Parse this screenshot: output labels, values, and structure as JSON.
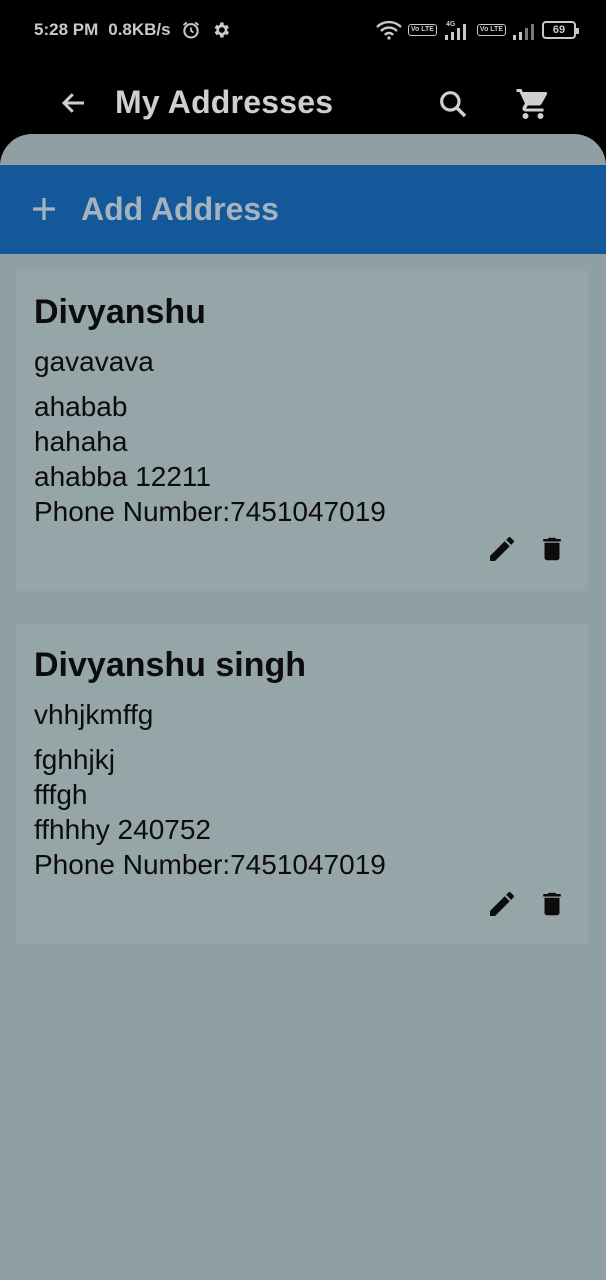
{
  "status_bar": {
    "time": "5:28 PM",
    "speed": "0.8KB/s",
    "network_type": "4G",
    "volte_label": "Vo LTE",
    "battery": "69",
    "icons": [
      "alarm-icon",
      "settings-icon",
      "wifi-icon",
      "signal-icon",
      "battery-icon"
    ]
  },
  "app_bar": {
    "title": "My Addresses",
    "icons": [
      "back-arrow-icon",
      "search-icon",
      "cart-icon"
    ]
  },
  "add_address": {
    "label": "Add Address",
    "icon": "plus-icon"
  },
  "addresses": [
    {
      "name": "Divyanshu",
      "line1": "gavavava",
      "line2": "ahabab",
      "line3": "hahaha",
      "line4": "ahabba 12211",
      "phone": "Phone Number:7451047019"
    },
    {
      "name": "Divyanshu singh",
      "line1": "vhhjkmffg",
      "line2": "fghhjkj",
      "line3": "fffgh",
      "line4": "ffhhhy 240752",
      "phone": "Phone Number:7451047019"
    }
  ],
  "colors": {
    "background": "#000000",
    "panel": "#909fa3",
    "card": "#96a5a8",
    "add_bar": "#13599a",
    "text_dark": "#0c0c0c",
    "text_light": "#cfcfcf"
  }
}
